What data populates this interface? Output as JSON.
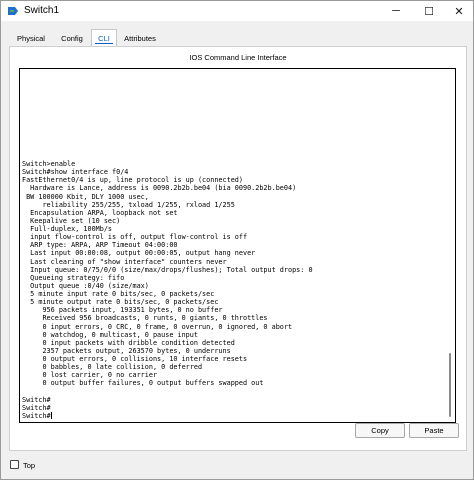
{
  "window": {
    "title": "Switch1",
    "minimize_glyph": "─",
    "maximize_glyph": "☐",
    "close_glyph": "✕"
  },
  "tabs": [
    {
      "label": "Physical",
      "active": false
    },
    {
      "label": "Config",
      "active": false
    },
    {
      "label": "CLI",
      "active": true
    },
    {
      "label": "Attributes",
      "active": false
    }
  ],
  "cli": {
    "title": "IOS Command Line Interface",
    "output": "Switch>enable\nSwitch#show interface f0/4\nFastEthernet0/4 is up, line protocol is up (connected)\n  Hardware is Lance, address is 0090.2b2b.be04 (bia 0090.2b2b.be04)\n BW 100000 Kbit, DLY 1000 usec,\n     reliability 255/255, txload 1/255, rxload 1/255\n  Encapsulation ARPA, loopback not set\n  Keepalive set (10 sec)\n  Full-duplex, 100Mb/s\n  input flow-control is off, output flow-control is off\n  ARP type: ARPA, ARP Timeout 04:00:00\n  Last input 00:00:08, output 00:00:05, output hang never\n  Last clearing of \"show interface\" counters never\n  Input queue: 0/75/0/0 (size/max/drops/flushes); Total output drops: 0\n  Queueing strategy: fifo\n  Output queue :0/40 (size/max)\n  5 minute input rate 0 bits/sec, 0 packets/sec\n  5 minute output rate 0 bits/sec, 0 packets/sec\n     956 packets input, 193351 bytes, 0 no buffer\n     Received 956 broadcasts, 0 runts, 0 giants, 0 throttles\n     0 input errors, 0 CRC, 0 frame, 0 overrun, 0 ignored, 0 abort\n     0 watchdog, 0 multicast, 0 pause input\n     0 input packets with dribble condition detected\n     2357 packets output, 263570 bytes, 0 underruns\n     0 output errors, 0 collisions, 10 interface resets\n     0 babbles, 0 late collision, 0 deferred\n     0 lost carrier, 0 no carrier\n     0 output buffer failures, 0 output buffers swapped out\n\nSwitch#\nSwitch#\nSwitch#"
  },
  "buttons": {
    "copy": "Copy",
    "paste": "Paste"
  },
  "footer": {
    "top_label": "Top",
    "top_checked": false
  },
  "colors": {
    "accent": "#0a5ebf",
    "icon_blue": "#1e6fd0",
    "icon_green": "#4caf50"
  }
}
